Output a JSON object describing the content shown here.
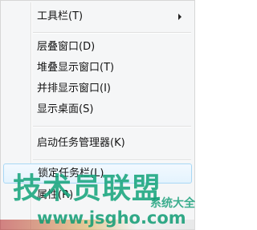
{
  "menu": {
    "items": [
      {
        "label": "工具栏(T)",
        "submenu": true
      },
      {
        "label": "层叠窗口(D)"
      },
      {
        "label": "堆叠显示窗口(T)"
      },
      {
        "label": "并排显示窗口(I)"
      },
      {
        "label": "显示桌面(S)"
      },
      {
        "label": "启动任务管理器(K)"
      },
      {
        "label": "锁定任务栏(L)",
        "highlighted": true
      },
      {
        "label": "属性(R)"
      }
    ]
  },
  "watermark": {
    "brand": "技术员联盟",
    "url": "www.jsgho.com",
    "side": "系统大全"
  },
  "colors": {
    "highlight_border": "#a8d8f5",
    "watermark": "#12a37a",
    "menu_bg": "#f5f6f7"
  }
}
